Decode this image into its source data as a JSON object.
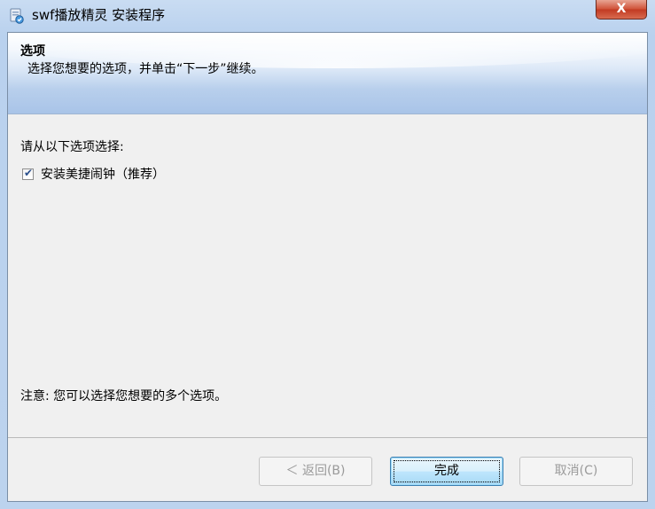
{
  "window": {
    "title": "swf播放精灵 安装程序",
    "close_label": "X"
  },
  "header": {
    "title": "选项",
    "subtitle": "选择您想要的选项，并单击“下一步”继续。"
  },
  "body": {
    "prompt": "请从以下选项选择:",
    "options": [
      {
        "label": "安装美捷闹钟（推荐）",
        "checked": true
      }
    ],
    "note": "注意: 您可以选择您想要的多个选项。"
  },
  "buttons": {
    "back": "＜ 返回(B)",
    "finish": "完成",
    "cancel": "取消(C)"
  }
}
